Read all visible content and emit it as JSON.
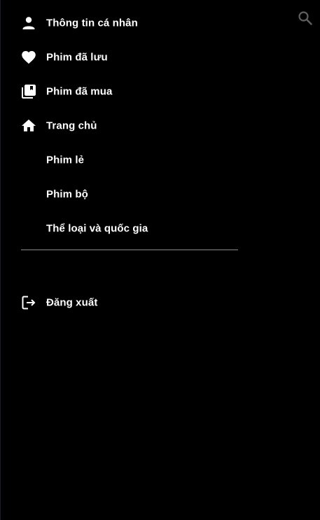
{
  "menu": {
    "items": [
      {
        "label": "Thông tin cá nhân",
        "icon": "person-icon"
      },
      {
        "label": "Phim đã lưu",
        "icon": "heart-icon"
      },
      {
        "label": "Phim đã mua",
        "icon": "library-icon"
      },
      {
        "label": "Trang chủ",
        "icon": "home-icon"
      },
      {
        "label": "Phim lẻ"
      },
      {
        "label": "Phim bộ"
      },
      {
        "label": "Thể loại và quốc gia"
      }
    ],
    "logout": {
      "label": "Đăng xuất",
      "icon": "logout-icon"
    }
  },
  "toolbar": {
    "search_icon": "search-icon"
  },
  "colors": {
    "background": "#000000",
    "text": "#ffffff",
    "divider": "#8a8a8a",
    "search_icon": "#5f5f5f"
  }
}
